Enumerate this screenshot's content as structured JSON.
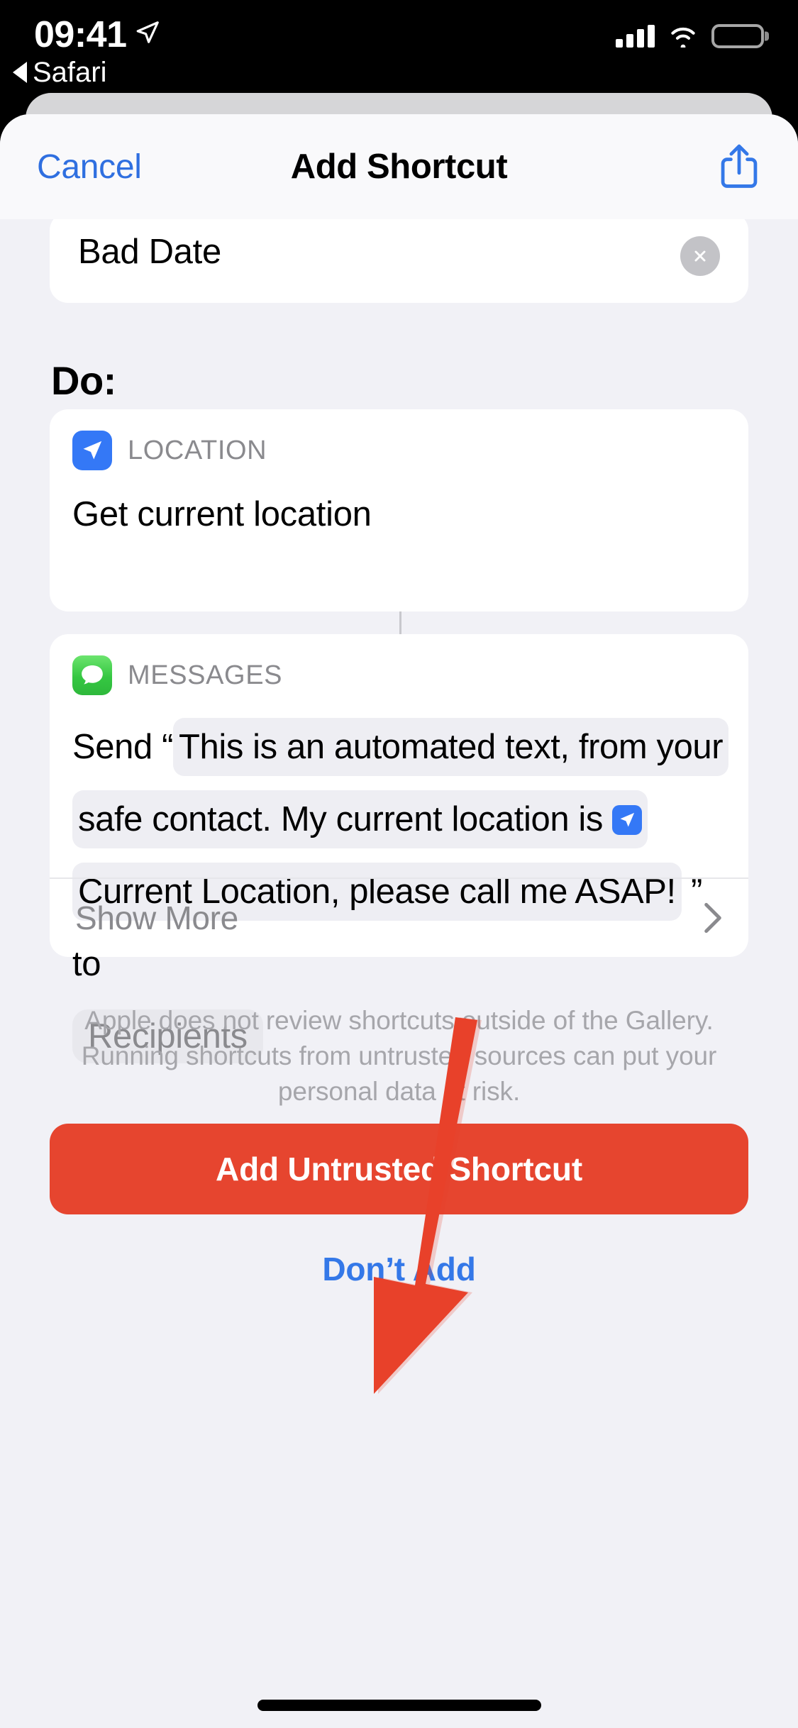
{
  "status_bar": {
    "time": "09:41",
    "location_icon": "location-arrow-icon",
    "back_app": "Safari",
    "cellular_icon": "cellular-bars-icon",
    "wifi_icon": "wifi-icon",
    "battery_icon": "battery-full-icon"
  },
  "navbar": {
    "cancel_label": "Cancel",
    "title": "Add Shortcut",
    "share_icon": "share-icon"
  },
  "name_field": {
    "value": "Bad Date",
    "clear_icon": "clear-circle-icon"
  },
  "section": {
    "do_heading": "Do:"
  },
  "actions": [
    {
      "app": "LOCATION",
      "icon": "location-app-icon",
      "body": "Get current location"
    },
    {
      "app": "MESSAGES",
      "icon": "messages-app-icon",
      "send_label": "Send",
      "open_quote": "“",
      "message_text": "This is an automated text, from your safe contact. My current location is",
      "location_token": "Current Location",
      "location_token_icon": "location-token-icon",
      "message_text_2": ", please call me ASAP!",
      "close_quote": "”",
      "to_label": "to",
      "recipients_placeholder": "Recipients",
      "show_more_label": "Show More",
      "chevron_icon": "chevron-right-icon"
    }
  ],
  "disclaimer": "Apple does not review shortcuts outside of the Gallery. Running shortcuts from untrusted sources can put your personal data at risk.",
  "buttons": {
    "primary_label": "Add Untrusted Shortcut",
    "secondary_label": "Don’t Add"
  },
  "annotation": {
    "arrow_icon": "red-down-arrow-annotation",
    "arrow_color": "#e8412a"
  },
  "colors": {
    "accent_blue": "#2f6fe0",
    "destructive_red": "#e6452f",
    "sheet_background": "#f1f1f6",
    "card_background": "#ffffff",
    "location_blue": "#3478f6",
    "messages_green": "#35c742",
    "muted_text": "#8a8a8e"
  },
  "home_indicator": "home-indicator"
}
